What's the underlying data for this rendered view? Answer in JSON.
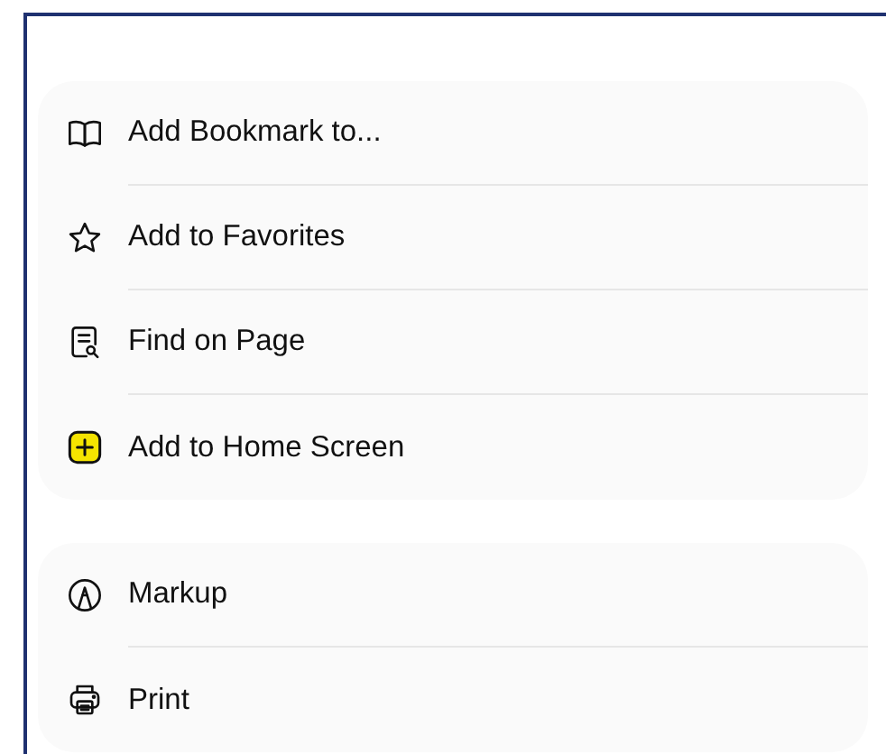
{
  "groups": [
    {
      "items": [
        {
          "kind": "book",
          "label": "Add Bookmark to..."
        },
        {
          "kind": "star",
          "label": "Add to Favorites"
        },
        {
          "kind": "find",
          "label": "Find on Page"
        },
        {
          "kind": "plus",
          "label": "Add to Home Screen"
        }
      ]
    },
    {
      "items": [
        {
          "kind": "markup",
          "label": "Markup"
        },
        {
          "kind": "printer",
          "label": "Print"
        }
      ]
    }
  ]
}
